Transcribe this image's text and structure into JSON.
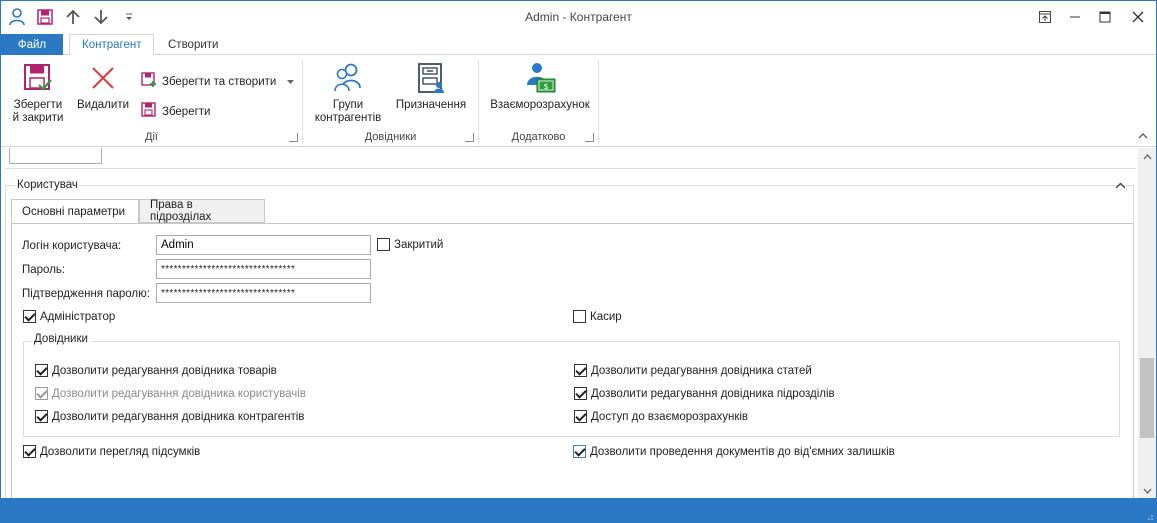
{
  "window": {
    "title": "Admin - Контрагент"
  },
  "quick_access": [
    "user-icon",
    "save-icon",
    "arrow-up-icon",
    "arrow-down-icon",
    "customize-qat-icon"
  ],
  "ribbon_tabs": {
    "file": "Файл",
    "tabs": [
      "Контрагент",
      "Створити"
    ]
  },
  "ribbon": {
    "groups": {
      "actions": {
        "label": "Дії",
        "save_close": "Зберегти\nй закрити",
        "delete": "Видалити",
        "save_create": "Зберегти та створити",
        "save": "Зберегти"
      },
      "references": {
        "label": "Довідники",
        "groups": "Групи\nконтрагентів",
        "assignments": "Призначення"
      },
      "extra": {
        "label": "Додатково",
        "settlements": "Взаєморозрахунок"
      }
    }
  },
  "user_section": {
    "title": "Користувач",
    "tabs": [
      "Основні параметри",
      "Права в підрозділах"
    ],
    "login_label": "Логін користувача:",
    "login_value": "Admin",
    "closed_label": "Закритий",
    "closed_checked": false,
    "password_label": "Пароль:",
    "password_value": "********************************",
    "confirm_label": "Підтвердження паролю:",
    "confirm_value": "********************************",
    "admin_label": "Адміністратор",
    "admin_checked": true,
    "cashier_label": "Касир",
    "cashier_checked": false,
    "references_title": "Довідники",
    "references_left": [
      {
        "label": "Дозволити редагування довідника товарів",
        "checked": true,
        "disabled": false
      },
      {
        "label": "Дозволити редагування довідника користувачів",
        "checked": true,
        "disabled": true
      },
      {
        "label": "Дозволити редагування довідника контрагентів",
        "checked": true,
        "disabled": false
      }
    ],
    "references_right": [
      {
        "label": "Дозволити редагування довідника статей",
        "checked": true,
        "disabled": false
      },
      {
        "label": "Дозволити редагування довідника підрозділів",
        "checked": true,
        "disabled": false
      },
      {
        "label": "Доступ до взаєморозрахунків",
        "checked": true,
        "disabled": false
      }
    ],
    "allow_totals_label": "Дозволити перегляд підсумків",
    "allow_totals_checked": true,
    "allow_negative_label": "Дозволити проведення документів до від'ємних залишків",
    "allow_negative_checked": true
  },
  "colors": {
    "accent": "#2b78c5",
    "status_bar": "#2b78c5"
  }
}
